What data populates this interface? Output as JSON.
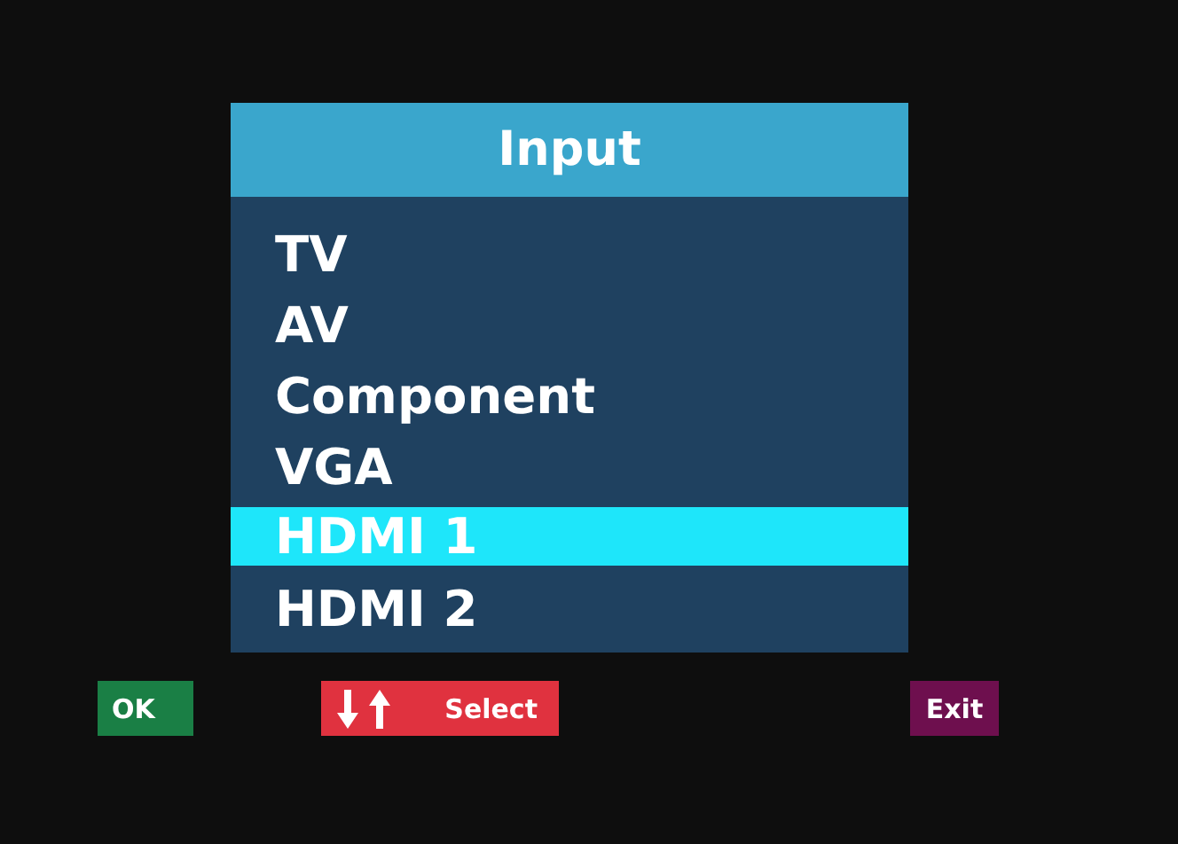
{
  "menu": {
    "title": "Input",
    "items": [
      {
        "label": "TV",
        "selected": false
      },
      {
        "label": "AV",
        "selected": false
      },
      {
        "label": "Component",
        "selected": false
      },
      {
        "label": "VGA",
        "selected": false
      },
      {
        "label": "HDMI 1",
        "selected": true
      },
      {
        "label": "HDMI 2",
        "selected": false
      }
    ]
  },
  "buttons": [
    {
      "kind": "ok",
      "label": "OK"
    },
    {
      "kind": "select",
      "label": "Select"
    },
    {
      "kind": "exit",
      "label": "Exit"
    }
  ]
}
